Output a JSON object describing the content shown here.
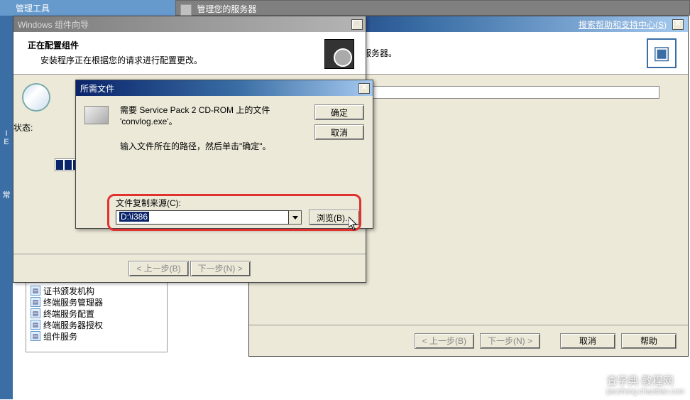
{
  "taskbar": {
    "item1": "管理工具",
    "item2": "管理您的服务器"
  },
  "back": {
    "search_label": "搜索帮助和支持中心(S)",
    "header_text": "正在将选择的角色添加到此服务器。",
    "footer": {
      "prev": "< 上一步(B)",
      "next": "下一步(N) >",
      "cancel": "取消",
      "help": "帮助"
    }
  },
  "wizard1": {
    "title": "Windows 组件向导",
    "h1": "正在配置组件",
    "h2": "安装程序正在根据您的请求进行配置更改。",
    "status_label": "状态:",
    "footer": {
      "prev": "< 上一步(B)",
      "next": "下一步(N) >"
    }
  },
  "dialog2": {
    "title": "所需文件",
    "msg_line1": "需要 Service Pack 2 CD-ROM 上的文件",
    "msg_line2": "'convlog.exe'。",
    "msg2": "输入文件所在的路径，然后单击\"确定\"。",
    "copy_label": "文件复制来源(C):",
    "copy_value": "D:\\i386",
    "ok": "确定",
    "cancel": "取消",
    "browse": "浏览(B)..."
  },
  "tree": {
    "i1": "证书颁发机构",
    "i2": "终端服务管理器",
    "i3": "终端服务配置",
    "i4": "终端服务器授权",
    "i5": "组件服务"
  },
  "leftstrip": {
    "t1": "I",
    "t2": "E",
    "t3": "常"
  },
  "watermark": {
    "main": "查字典   教程网",
    "sub": "jiaocheng.chazidian.com"
  }
}
